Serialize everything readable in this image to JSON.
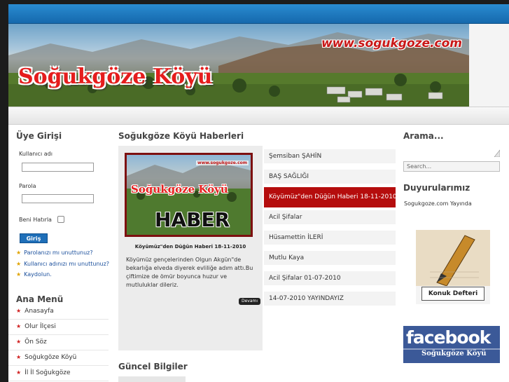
{
  "banner": {
    "title": "Soğukgöze Köyü",
    "url": "www.sogukgoze.com"
  },
  "login": {
    "heading": "Üye Girişi",
    "username_label": "Kullanıcı adı",
    "password_label": "Parola",
    "remember_label": "Beni Hatırla",
    "submit_label": "Giriş",
    "links": [
      "Parolanızı mı unuttunuz?",
      "Kullanıcı adınızı mı unuttunuz?",
      "Kaydolun."
    ]
  },
  "main_menu": {
    "heading": "Ana Menü",
    "items": [
      "Anasayfa",
      "Olur İlçesi",
      "Ön Söz",
      "Soğukgöze Köyü",
      "İl İl Soğukgöze"
    ]
  },
  "news": {
    "heading": "Soğukgöze Köyü Haberleri",
    "image_text": {
      "title": "Soğukgöze Köyü",
      "big": "HABER",
      "url": "www.sogukgoze.com"
    },
    "featured_title": "Köyümüz\"den Düğün Haberi 18-11-2010",
    "featured_desc": "Köyümüz gençelerinden Olgun Akgün\"de bekarlığa elveda diyerek evliliğe adım attı.Bu çiftimize de ömür boyunca huzur ve mutluluklar dileriz.",
    "more_label": "Devamı",
    "list": [
      "Şemsiban ŞAHİN",
      "BAŞ SAĞLIĞI",
      "Köyümüz\"den Düğün Haberi 18-11-2010",
      "Acil Şifalar",
      "Hüsamettin İLERİ",
      "Mutlu Kaya",
      "Acil Şifalar 01-07-2010",
      "14-07-2010 YAYINDAYIZ"
    ],
    "active_index": 2
  },
  "guncel": {
    "heading": "Güncel Bilgiler"
  },
  "search": {
    "heading": "Arama...",
    "placeholder": "Search..."
  },
  "announcements": {
    "heading": "Duyurularımız",
    "text": "Sogukgoze.com Yayında"
  },
  "guestbook": {
    "label": "Konuk Defteri"
  },
  "facebook": {
    "brand": "facebook",
    "caption": "Soğukgöze Köyü"
  },
  "colors": {
    "topbar": "#1f78bf",
    "accent_red": "#b50d0d",
    "link_blue": "#1a4f9c"
  }
}
